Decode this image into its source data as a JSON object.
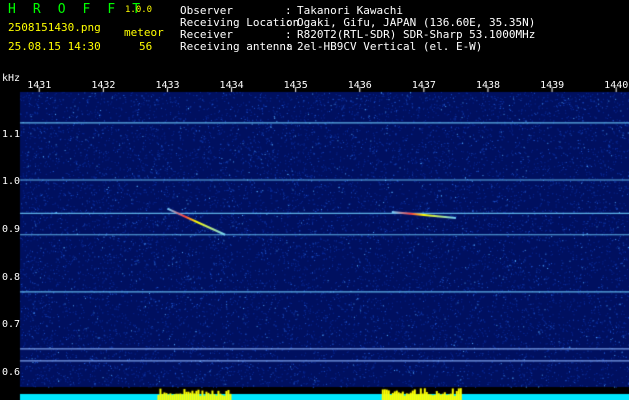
{
  "app": {
    "title": "H R O F F T",
    "version": "1.0.0",
    "filename": "2508151430.png",
    "mode_label": "meteor",
    "datetime": "25.08.15 14:30",
    "count": "56"
  },
  "info": {
    "rows": [
      {
        "label": "Observer",
        "value": "Takanori Kawachi"
      },
      {
        "label": "Receiving Location",
        "value": "Ogaki, Gifu, JAPAN (136.60E, 35.35N)"
      },
      {
        "label": "Receiver",
        "value": "R820T2(RTL-SDR) SDR-Sharp 53.1000MHz"
      },
      {
        "label": "Receiving antenna",
        "value": "2el-HB9CV Vertical (el. E-W)"
      }
    ]
  },
  "colors": {
    "header_green": "#00ff00",
    "header_yellow": "#ffff00",
    "background": "#000000",
    "spectrogram_base": "#001060",
    "signal_line": "#6fd0ff",
    "bottom_bar": "#00e8ff",
    "echo": "#ffff00"
  },
  "chart_data": {
    "type": "heatmap",
    "ylabel": "kHz",
    "x_ticks": [
      "1431",
      "1432",
      "1433",
      "1434",
      "1435",
      "1436",
      "1437",
      "1438",
      "1439",
      "1440"
    ],
    "x_range": [
      1430.7,
      1440.2
    ],
    "y_ticks": [
      "1.1",
      "1.0",
      "0.9",
      "0.8",
      "0.7",
      "0.6"
    ],
    "y_range": [
      0.57,
      1.19
    ],
    "carriers_khz": [
      1.125,
      1.005,
      0.935,
      0.89,
      0.77,
      0.65,
      0.625
    ],
    "meteor_echoes": [
      {
        "t_start": 1433.0,
        "t_end": 1433.9,
        "f_start": 0.945,
        "f_end": 0.89
      },
      {
        "t_start": 1436.5,
        "t_end": 1437.5,
        "f_start": 0.938,
        "f_end": 0.925
      }
    ]
  }
}
